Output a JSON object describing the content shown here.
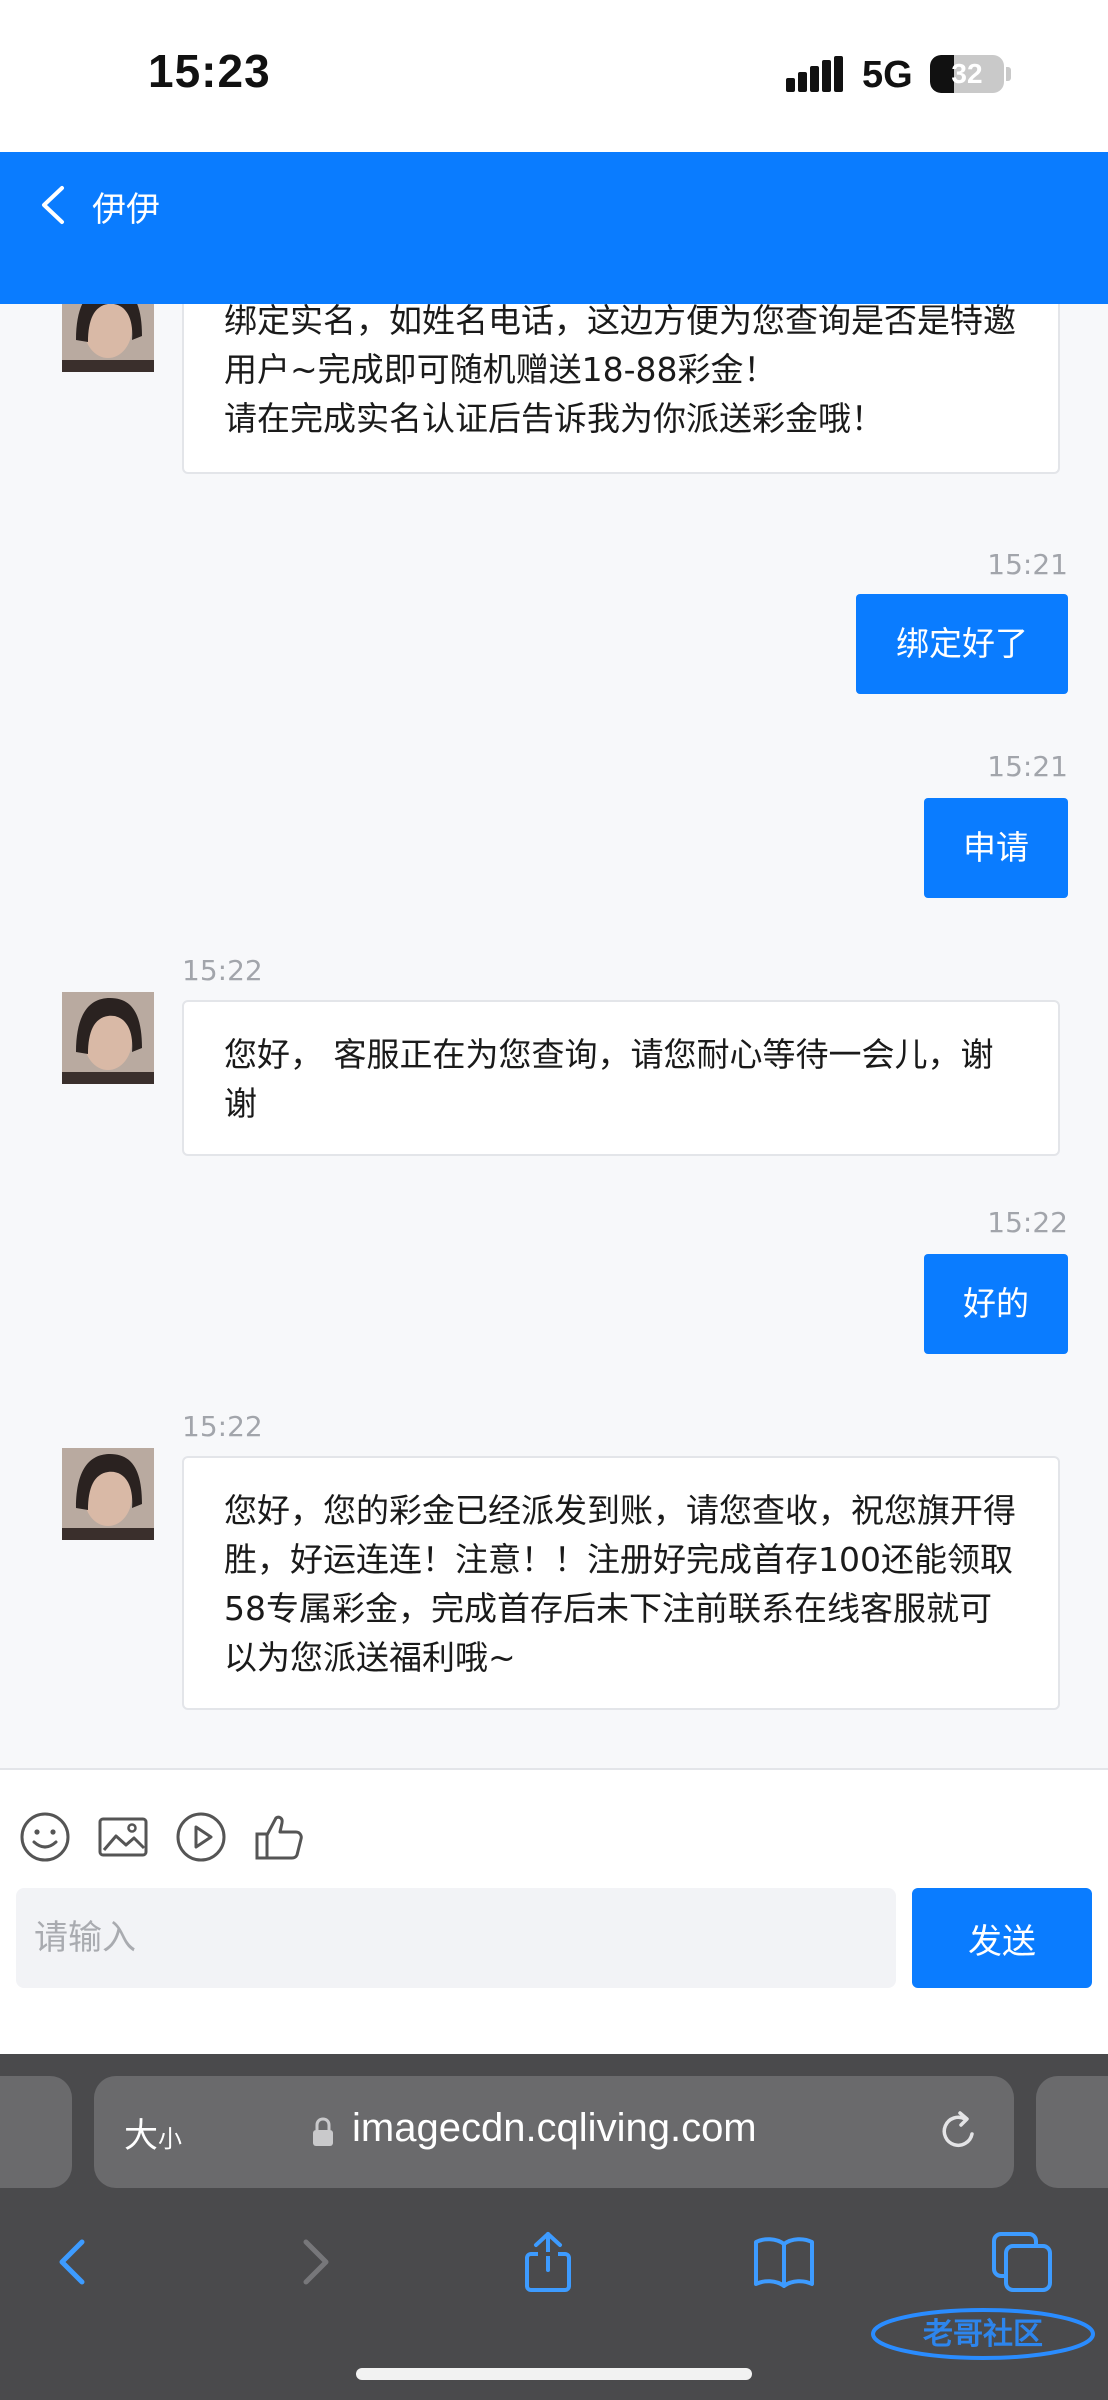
{
  "status_bar": {
    "time": "15:23",
    "network": "5G",
    "battery": "32",
    "battery_level": 0.32,
    "icons": [
      "signal-bars-icon",
      "battery-icon"
    ]
  },
  "header": {
    "back_icon": "chevron-left-icon",
    "title": "伊伊"
  },
  "messages": [
    {
      "side": "in",
      "text": "绑定实名，如姓名电话，这边方便为您查询是否是特邀用户~完成即可随机赠送18-88彩金！\n请在完成实名认证后告诉我为你派送彩金哦！"
    },
    {
      "side": "out",
      "time": "15:21",
      "text": "绑定好了"
    },
    {
      "side": "out",
      "time": "15:21",
      "text": "申请"
    },
    {
      "side": "in",
      "time": "15:22",
      "text": "您好， 客服正在为您查询，请您耐心等待一会儿，谢谢"
    },
    {
      "side": "out",
      "time": "15:22",
      "text": "好的"
    },
    {
      "side": "in",
      "time": "15:22",
      "text": "您好，您的彩金已经派发到账，请您查收，祝您旗开得胜，好运连连！注意！！注册好完成首存100还能领取58专属彩金，完成首存后未下注前联系在线客服就可以为您派送福利哦~"
    }
  ],
  "input_area": {
    "tools": [
      "emoji-icon",
      "image-icon",
      "video-icon",
      "thumbs-up-icon"
    ],
    "placeholder": "请输入",
    "value": "",
    "send_label": "发送"
  },
  "browser": {
    "text_size_big": "大",
    "text_size_small": "小",
    "url": "imagecdn.cqliving.com",
    "icons": [
      "lock-icon",
      "reload-icon",
      "back-icon",
      "forward-icon",
      "share-icon",
      "bookmarks-icon",
      "tabs-icon"
    ]
  },
  "colors": {
    "accent": "#0a7cff",
    "page_bg": "#f7f8fa",
    "browser_bg": "#4a4a4c"
  }
}
